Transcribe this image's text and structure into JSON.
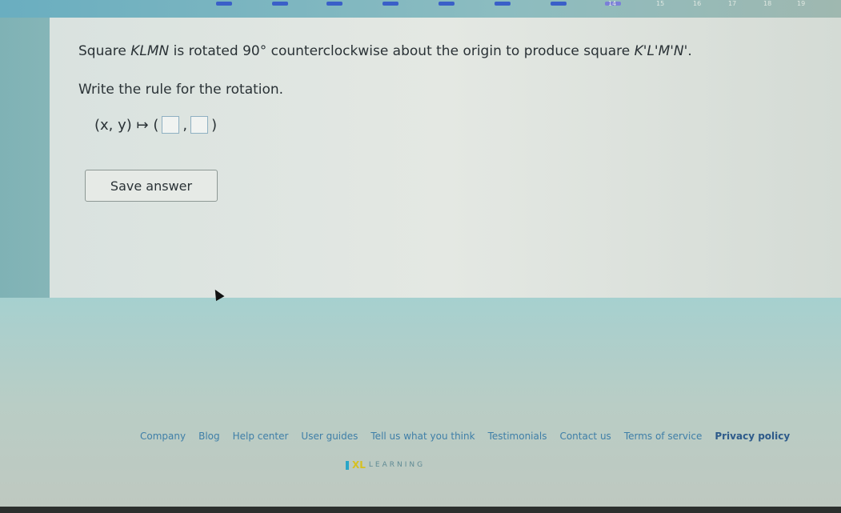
{
  "top_numbers": [
    "14",
    "15",
    "16",
    "17",
    "18",
    "19"
  ],
  "question": {
    "line1_prefix": "Square ",
    "figure": "KLMN",
    "line1_mid": " is rotated ",
    "angle": "90°",
    "line1_suffix": " counterclockwise about the origin to produce square ",
    "image_figure": "K'L'M'N'",
    "line1_end": ".",
    "line2": "Write the rule for the rotation.",
    "rule_lhs": "(x, y) ↦ (",
    "rule_comma": ",",
    "rule_close": ")",
    "answer_x": "",
    "answer_y": ""
  },
  "save_button": "Save answer",
  "footer": {
    "links": [
      "Company",
      "Blog",
      "Help center",
      "User guides",
      "Tell us what you think",
      "Testimonials",
      "Contact us",
      "Terms of service",
      "Privacy policy"
    ],
    "logo_text": "LEARNING",
    "logo_mark": "XL"
  }
}
